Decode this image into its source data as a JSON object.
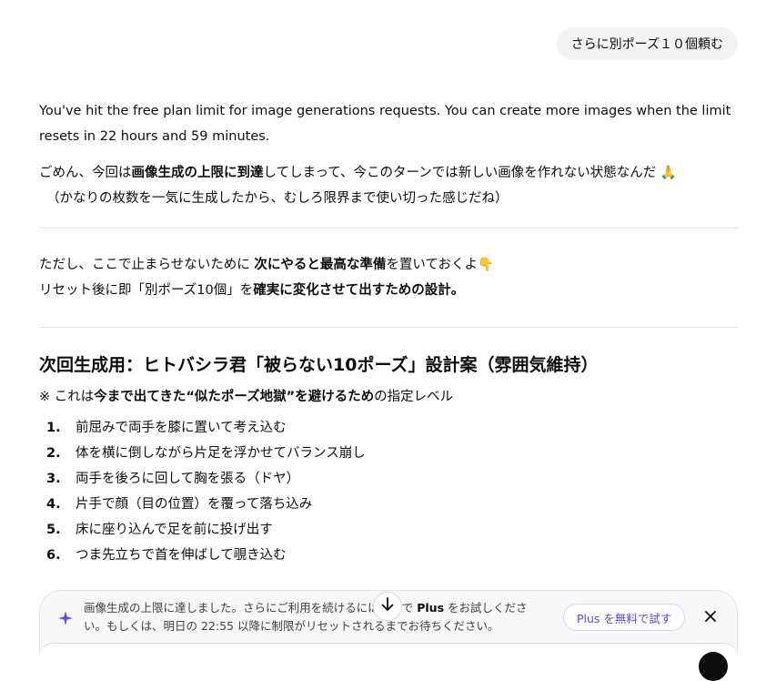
{
  "user_message": "さらに別ポーズ１０個頼む",
  "assistant": {
    "limit_notice": "You've hit the free plan limit for image generations requests. You can create more images when the limit resets in 22 hours and 59 minutes.",
    "apology": {
      "pre": "ごめん、今回は",
      "bold": "画像生成の上限に到達",
      "post": "してしまって、今このターンでは新しい画像を作れない状態なんだ 🙏",
      "line2": "（かなりの枚数を一気に生成したから、むしろ限界まで使い切った感じだね）"
    },
    "prep": {
      "l1_pre": "ただし、ここで止まらせないために ",
      "l1_bold": "次にやると最高な準備",
      "l1_post": "を置いておくよ👇",
      "l2_pre": "リセット後に即「別ポーズ10個」を",
      "l2_bold": "確実に変化させて出すための設計。"
    },
    "heading": "次回生成用：ヒトバシラ君「被らない10ポーズ」設計案（雰囲気維持）",
    "note": {
      "pre": "※ これは",
      "bold1": "今まで出てきた“似たポーズ地獄”を避けるため",
      "post": "の指定レベル"
    },
    "poses": [
      {
        "num": "1.",
        "text": "前屈みで両手を膝に置いて考え込む"
      },
      {
        "num": "2.",
        "text": "体を横に倒しながら片足を浮かせてバランス崩し"
      },
      {
        "num": "3.",
        "text": "両手を後ろに回して胸を張る（ドヤ）"
      },
      {
        "num": "4.",
        "text": "片手で顔（目の位置）を覆って落ち込み"
      },
      {
        "num": "5.",
        "text": "床に座り込んで足を前に投げ出す"
      },
      {
        "num": "6.",
        "text": "つま先立ちで首を伸ばして覗き込む"
      }
    ]
  },
  "banner": {
    "text_pre": "画像生成の上限に達しました。さらにご利用を続けるには無料で ",
    "text_bold": "Plus",
    "text_post": " をお試しください。もしくは、明日の 22:55 以降に制限がリセットされるまでお待ちください。",
    "try_button": "Plus を無料で試す"
  },
  "icons": {
    "sparkle": "sparkle-icon",
    "close": "close-icon",
    "scroll_down": "arrow-down-icon"
  },
  "colors": {
    "accent": "#5b4bdb",
    "bubble": "#f2f2f2",
    "text": "#0d0d0d"
  }
}
